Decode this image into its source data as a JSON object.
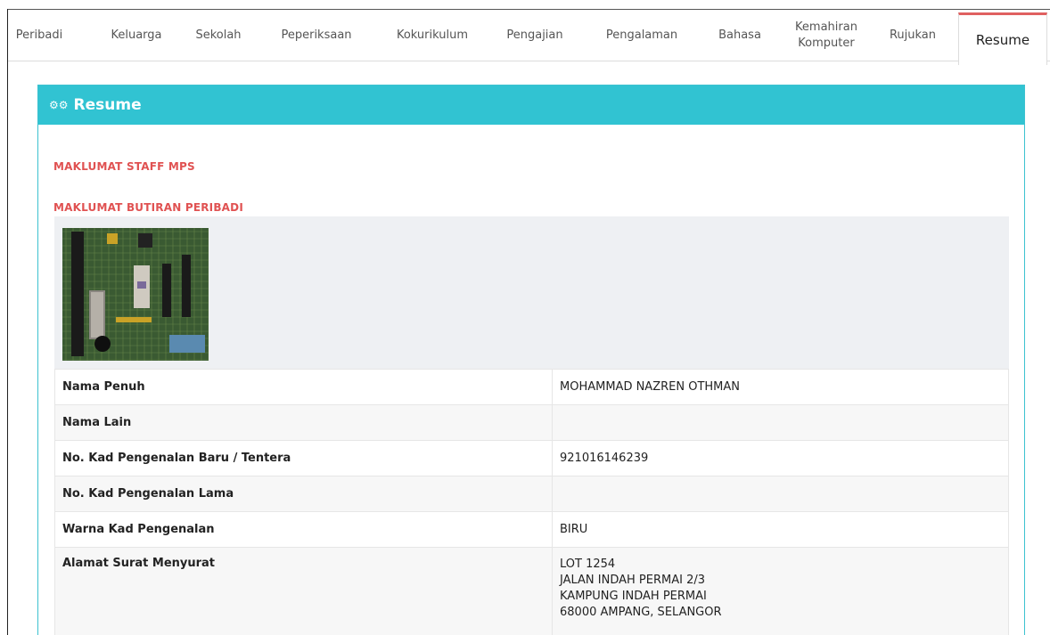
{
  "tabs": [
    {
      "label": "Peribadi",
      "active": false
    },
    {
      "label": "Keluarga",
      "active": false
    },
    {
      "label": "Sekolah",
      "active": false
    },
    {
      "label": "Peperiksaan",
      "active": false
    },
    {
      "label": "Kokurikulum",
      "active": false
    },
    {
      "label": "Pengajian",
      "active": false
    },
    {
      "label": "Pengalaman",
      "active": false
    },
    {
      "label": "Bahasa",
      "active": false
    },
    {
      "label": "Kemahiran Komputer",
      "active": false
    },
    {
      "label": "Rujukan",
      "active": false
    },
    {
      "label": "Resume",
      "active": true
    }
  ],
  "panel": {
    "icon": "gears-icon",
    "title": "Resume",
    "accent_color": "#31c3d2"
  },
  "sections": {
    "staff": "MAKLUMAT STAFF MPS",
    "personal": "MAKLUMAT BUTIRAN PERIBADI",
    "heading_color": "#e05252"
  },
  "fields": [
    {
      "label": "Nama Penuh",
      "value": "MOHAMMAD NAZREN OTHMAN"
    },
    {
      "label": "Nama Lain",
      "value": ""
    },
    {
      "label": "No. Kad Pengenalan Baru / Tentera",
      "value": "921016146239"
    },
    {
      "label": "No. Kad Pengenalan Lama",
      "value": ""
    },
    {
      "label": "Warna Kad Pengenalan",
      "value": "BIRU"
    }
  ],
  "address": {
    "label": "Alamat Surat Menyurat",
    "lines": [
      "LOT 1254",
      "JALAN INDAH PERMAI 2/3",
      "KAMPUNG INDAH PERMAI",
      "68000 AMPANG, SELANGOR"
    ]
  }
}
